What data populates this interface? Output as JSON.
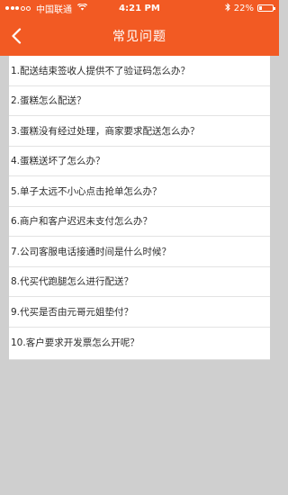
{
  "status_bar": {
    "carrier": "中国联通",
    "time": "4:21 PM",
    "battery_text": "22%",
    "battery_level": 0.22,
    "wifi_icon": "wifi-icon",
    "bluetooth_icon": "bluetooth-icon"
  },
  "nav": {
    "title": "常见问题",
    "back_icon": "chevron-left-icon"
  },
  "colors": {
    "accent": "#f25a23",
    "background": "#cfcfcf",
    "list_bg": "#ffffff",
    "text": "#2b2b2b"
  },
  "questions": [
    {
      "label": "1.配送结束签收人提供不了验证码怎么办？"
    },
    {
      "label": "2.蛋糕怎么配送？"
    },
    {
      "label": "3.蛋糕没有经过处理，商家要求配送怎么办？"
    },
    {
      "label": "4.蛋糕送坏了怎么办？"
    },
    {
      "label": "5.单子太远不小心点击抢单怎么办？"
    },
    {
      "label": "6.商户和客户迟迟未支付怎么办？"
    },
    {
      "label": "7.公司客服电话接通时间是什么时候？"
    },
    {
      "label": "8.代买代跑腿怎么进行配送？"
    },
    {
      "label": "9.代买是否由元哥元姐垫付？"
    },
    {
      "label": "10.客户要求开发票怎么开呢？"
    }
  ]
}
